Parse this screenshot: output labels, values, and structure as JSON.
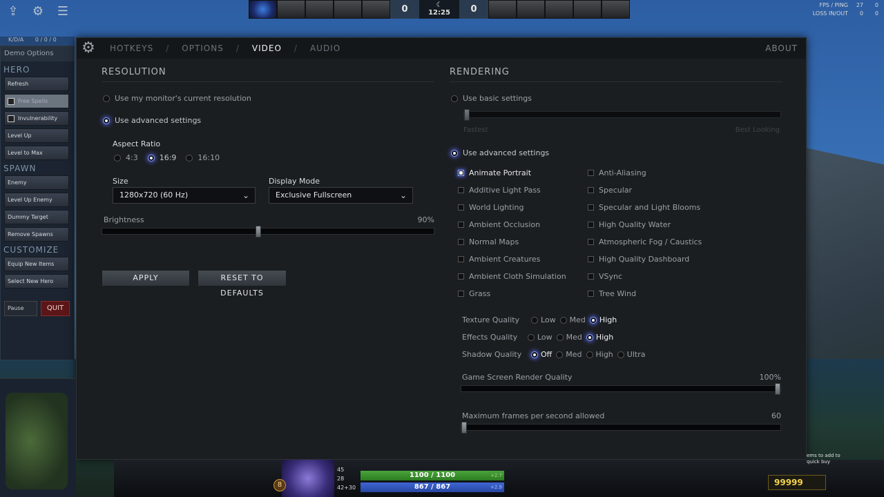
{
  "topbar": {
    "radiant_score": "0",
    "dire_score": "0",
    "clock_icon": "moon-icon",
    "clock": "12:25"
  },
  "fps": {
    "fps_label": "FPS / PING",
    "fps": "27",
    "ping": "0",
    "loss_label": "LOSS IN/OUT",
    "loss_in": "0",
    "loss_out": "0"
  },
  "demo": {
    "kda_label": "K/D/A",
    "kda": "0 / 0 / 0",
    "title": "Demo Options",
    "sections": {
      "hero": "HERO",
      "spawn": "SPAWN",
      "customize": "CUSTOMIZE"
    },
    "hero_buttons": {
      "refresh": "Refresh",
      "free_spells": "Free Spells",
      "invulnerability": "Invulnerability",
      "level_up": "Level Up",
      "level_max": "Level to Max"
    },
    "spawn_buttons": {
      "enemy": "Enemy",
      "level_up_enemy": "Level Up Enemy",
      "dummy_target": "Dummy Target",
      "remove_spawns": "Remove Spawns"
    },
    "customize_buttons": {
      "equip_items": "Equip New Items",
      "select_hero": "Select New Hero"
    },
    "pause": "Pause",
    "quit": "QUIT"
  },
  "dialog": {
    "tabs": {
      "hotkeys": "HOTKEYS",
      "options": "OPTIONS",
      "video": "VIDEO",
      "audio": "AUDIO"
    },
    "separator": "/",
    "about": "ABOUT",
    "resolution": {
      "title": "RESOLUTION",
      "use_monitor": "Use my monitor's current resolution",
      "use_advanced": "Use advanced settings",
      "aspect_label": "Aspect Ratio",
      "aspect_options": {
        "a43": "4:3",
        "a169": "16:9",
        "a1610": "16:10"
      },
      "aspect_selected": "16:9",
      "size_label": "Size",
      "size_value": "1280x720 (60 Hz)",
      "display_label": "Display Mode",
      "display_value": "Exclusive Fullscreen",
      "brightness_label": "Brightness",
      "brightness_value": "90%",
      "brightness_level": 0.47,
      "apply": "APPLY",
      "reset": "RESET TO DEFAULTS"
    },
    "rendering": {
      "title": "RENDERING",
      "use_basic": "Use basic settings",
      "fastest": "Fastest",
      "best_looking": "Best Looking",
      "use_advanced": "Use advanced settings",
      "left_options": {
        "animate_portrait": "Animate Portrait",
        "additive_light": "Additive Light Pass",
        "world_lighting": "World Lighting",
        "ambient_occlusion": "Ambient Occlusion",
        "normal_maps": "Normal Maps",
        "ambient_creatures": "Ambient Creatures",
        "ambient_cloth": "Ambient Cloth Simulation",
        "grass": "Grass"
      },
      "right_options": {
        "anti_aliasing": "Anti-Aliasing",
        "specular": "Specular",
        "specular_blooms": "Specular and Light Blooms",
        "hq_water": "High Quality Water",
        "fog_caustics": "Atmospheric Fog / Caustics",
        "hq_dashboard": "High Quality Dashboard",
        "vsync": "VSync",
        "tree_wind": "Tree Wind"
      },
      "texture_label": "Texture Quality",
      "effects_label": "Effects Quality",
      "shadow_label": "Shadow Quality",
      "q_low": "Low",
      "q_med": "Med",
      "q_high": "High",
      "q_off": "Off",
      "q_ultra": "Ultra",
      "texture_selected": "High",
      "effects_selected": "High",
      "shadow_selected": "Off",
      "render_quality_label": "Game Screen Render Quality",
      "render_quality_value": "100%",
      "render_quality_level": 1.0,
      "max_fps_label": "Maximum frames per second allowed",
      "max_fps_value": "60",
      "max_fps_level": 0.0
    }
  },
  "hud": {
    "level": "8",
    "stat_1": "45",
    "stat_2": "28",
    "stat_3": "42+30",
    "hp": "1100 / 1100",
    "hp_regen": "+2.7",
    "mana": "867 / 867",
    "mana_regen": "+2.9",
    "gold": "99999",
    "quickbuy": "ems to add to quick buy"
  }
}
